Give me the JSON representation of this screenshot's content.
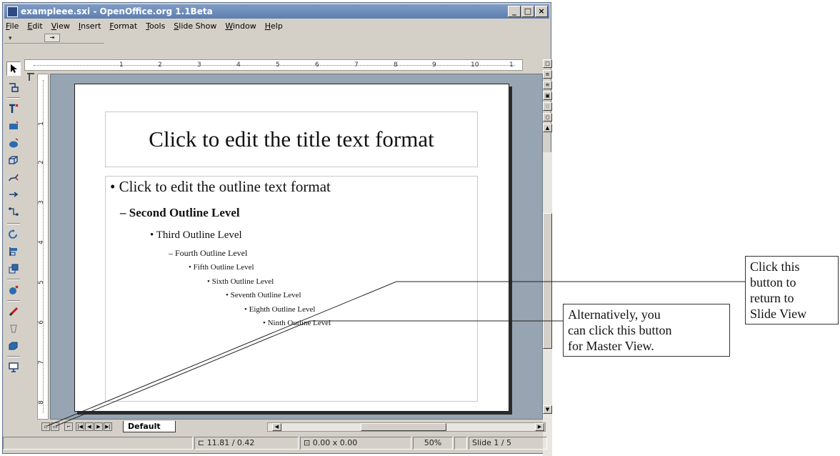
{
  "window": {
    "title": "exampleee.sxi - OpenOffice.org 1.1Beta",
    "min_label": "_",
    "max_label": "□",
    "close_label": "×"
  },
  "menu": [
    "File",
    "Edit",
    "View",
    "Insert",
    "Format",
    "Tools",
    "Slide Show",
    "Window",
    "Help"
  ],
  "ruler": {
    "h_ticks": [
      "1",
      "2",
      "3",
      "4",
      "5",
      "6",
      "7",
      "8",
      "9",
      "10",
      "1"
    ],
    "v_ticks": [
      "1",
      "2",
      "3",
      "4",
      "5",
      "6",
      "7",
      "8"
    ]
  },
  "slide": {
    "title": "Click to edit the title text format",
    "outline": [
      "• Click to edit the outline text format",
      "– Second Outline Level",
      "• Third Outline Level",
      "– Fourth Outline Level",
      "• Fifth Outline Level",
      "• Sixth Outline Level",
      "• Seventh Outline Level",
      "• Eighth Outline Level",
      "• Ninth Outline Level"
    ]
  },
  "tabs": {
    "default_label": "Default"
  },
  "status": {
    "position": "11.81 / 0.42",
    "size": "0.00 x 0.00",
    "zoom": "50%",
    "slide": "Slide 1 / 5"
  },
  "callouts": {
    "slide_view": [
      "Click this",
      "button to",
      "return to",
      "Slide View"
    ],
    "master_view": [
      "Alternatively, you",
      "can click this button",
      "for Master View."
    ]
  },
  "colors": {
    "titlebar": "#5d7fb0",
    "chrome": "#d4d0c8",
    "workspace": "#97a4b1"
  }
}
